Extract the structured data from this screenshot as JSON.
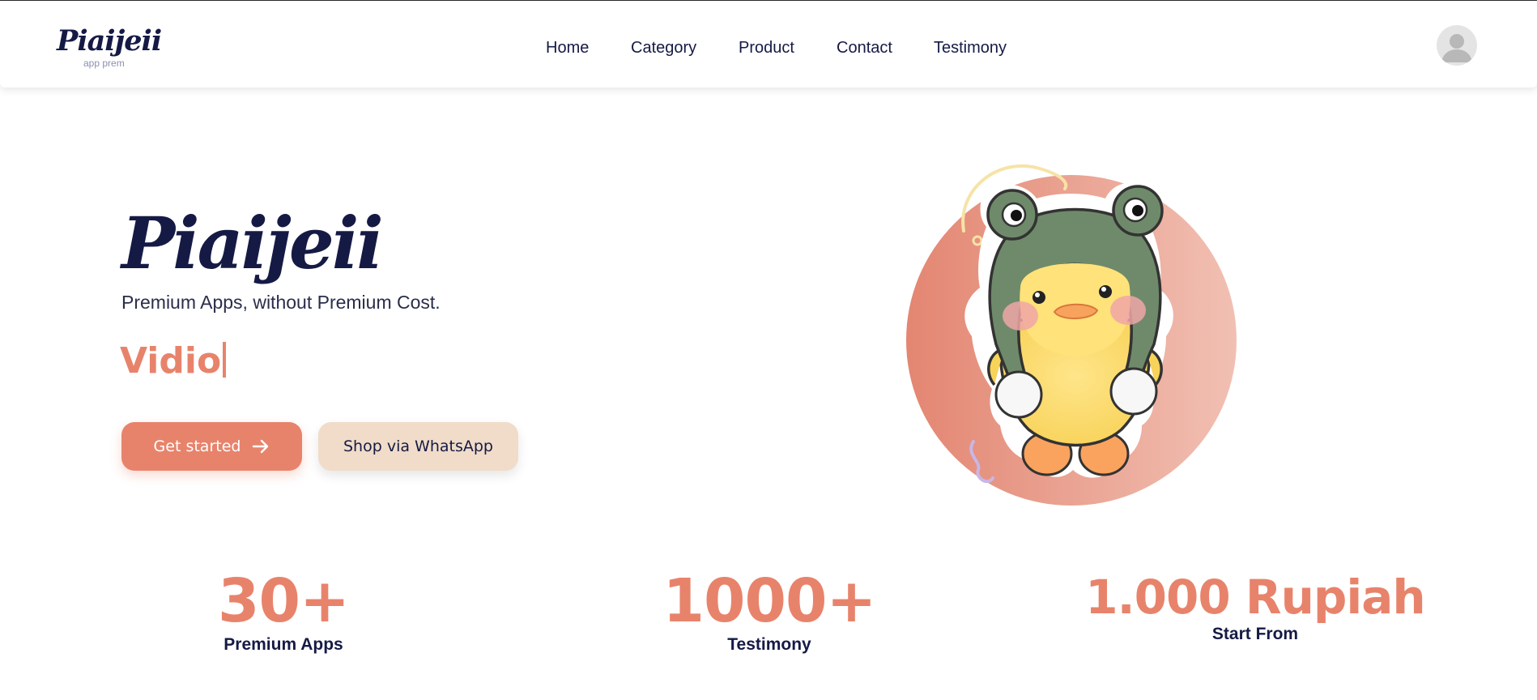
{
  "header": {
    "brand_name": "Piaijeii",
    "brand_tagline": "app prem",
    "nav": [
      "Home",
      "Category",
      "Product",
      "Contact",
      "Testimony"
    ]
  },
  "hero": {
    "title": "Piaijeii",
    "subtitle": "Premium Apps, without Premium Cost.",
    "typed_text": "Vidio",
    "primary_button": "Get started",
    "secondary_button": "Shop via WhatsApp"
  },
  "stats": [
    {
      "value": "30+",
      "label": "Premium Apps"
    },
    {
      "value": "1000+",
      "label": "Testimony"
    },
    {
      "value": "1.000 Rupiah",
      "label": "Start From"
    }
  ],
  "colors": {
    "accent": "#e8836b",
    "navy": "#151a45",
    "secondary_button_bg": "#f0dcc8"
  },
  "icons": {
    "arrow": "arrow-right-icon",
    "avatar": "user-avatar-icon"
  }
}
